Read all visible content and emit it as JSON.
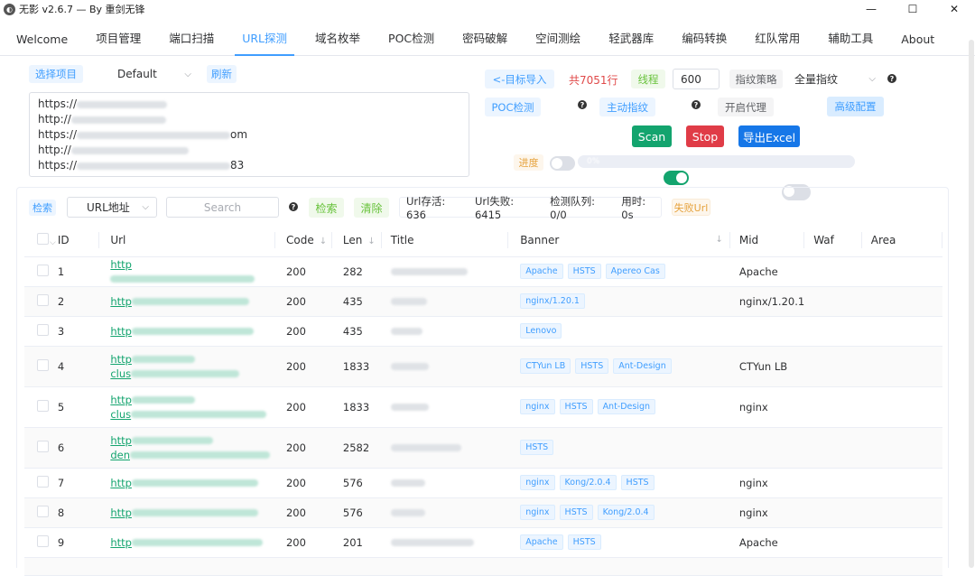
{
  "window": {
    "title": "无影 v2.6.7 — By 重剑无锋"
  },
  "tabs": [
    {
      "label": "Welcome",
      "active": false
    },
    {
      "label": "项目管理",
      "active": false
    },
    {
      "label": "端口扫描",
      "active": false
    },
    {
      "label": "URL探测",
      "active": true
    },
    {
      "label": "域名枚举",
      "active": false
    },
    {
      "label": "POC检测",
      "active": false
    },
    {
      "label": "密码破解",
      "active": false
    },
    {
      "label": "空间测绘",
      "active": false
    },
    {
      "label": "轻武器库",
      "active": false
    },
    {
      "label": "编码转换",
      "active": false
    },
    {
      "label": "红队常用",
      "active": false
    },
    {
      "label": "辅助工具",
      "active": false
    },
    {
      "label": "About",
      "active": false
    }
  ],
  "project": {
    "select_label": "选择项目",
    "value": "Default",
    "refresh_label": "刷新"
  },
  "targets": {
    "lines": [
      "https://",
      "http://",
      "https://",
      "http://",
      "https://"
    ],
    "suffix_3": "om",
    "suffix_5": "83"
  },
  "controls": {
    "import_label": "<-目标导入",
    "count_text": "共7051行",
    "threads_label": "线程",
    "threads_value": "600",
    "fingerprint_label": "指纹策略",
    "fingerprint_value": "全量指纹",
    "poc_label": "POC检测",
    "poc_on": false,
    "active_fp_label": "主动指纹",
    "active_fp_on": true,
    "proxy_label": "开启代理",
    "proxy_on": false,
    "advanced_label": "高级配置",
    "scan_label": "Scan",
    "stop_label": "Stop",
    "export_label": "导出Excel",
    "progress_label": "进度",
    "progress_text": "0%",
    "progress_value": 0
  },
  "filter": {
    "search_tag": "检索",
    "field_value": "URL地址",
    "search_placeholder": "Search",
    "search_button": "检索",
    "clear_button": "清除",
    "stats": {
      "alive": "Url存活: 636",
      "failed": "Url失败: 6415",
      "queue": "检测队列: 0/0",
      "time": "用时: 0s"
    },
    "failed_tag": "失败Url"
  },
  "table": {
    "headers": [
      "ID",
      "Url",
      "Code",
      "Len",
      "Title",
      "Banner",
      "Mid",
      "Waf",
      "Area"
    ],
    "rows": [
      {
        "id": "1",
        "url": [
          "http"
        ],
        "code": "200",
        "len": "282",
        "banners": [
          "Apache",
          "HSTS",
          "Apereo Cas"
        ],
        "mid": "Apache"
      },
      {
        "id": "2",
        "url": [
          "http"
        ],
        "code": "200",
        "len": "435",
        "banners": [
          "nginx/1.20.1"
        ],
        "mid": "nginx/1.20.1"
      },
      {
        "id": "3",
        "url": [
          "http"
        ],
        "code": "200",
        "len": "435",
        "banners": [
          "Lenovo"
        ],
        "mid": ""
      },
      {
        "id": "4",
        "url": [
          "http",
          "clus"
        ],
        "code": "200",
        "len": "1833",
        "banners": [
          "CTYun LB",
          "HSTS",
          "Ant-Design"
        ],
        "mid": "CTYun LB"
      },
      {
        "id": "5",
        "url": [
          "http",
          "clus"
        ],
        "code": "200",
        "len": "1833",
        "banners": [
          "nginx",
          "HSTS",
          "Ant-Design"
        ],
        "mid": "nginx"
      },
      {
        "id": "6",
        "url": [
          "http",
          "den"
        ],
        "code": "200",
        "len": "2582",
        "banners": [
          "HSTS"
        ],
        "mid": ""
      },
      {
        "id": "7",
        "url": [
          "http"
        ],
        "code": "200",
        "len": "576",
        "banners": [
          "nginx",
          "Kong/2.0.4",
          "HSTS"
        ],
        "mid": "nginx"
      },
      {
        "id": "8",
        "url": [
          "http"
        ],
        "code": "200",
        "len": "576",
        "banners": [
          "nginx",
          "HSTS",
          "Kong/2.0.4"
        ],
        "mid": "nginx"
      },
      {
        "id": "9",
        "url": [
          "http"
        ],
        "code": "200",
        "len": "201",
        "banners": [
          "Apache",
          "HSTS"
        ],
        "mid": "Apache"
      }
    ]
  },
  "colors": {
    "accent": "#409eff",
    "scan": "#13a46e",
    "stop": "#e03c47",
    "export": "#1677e8",
    "count": "#e04a4a"
  }
}
